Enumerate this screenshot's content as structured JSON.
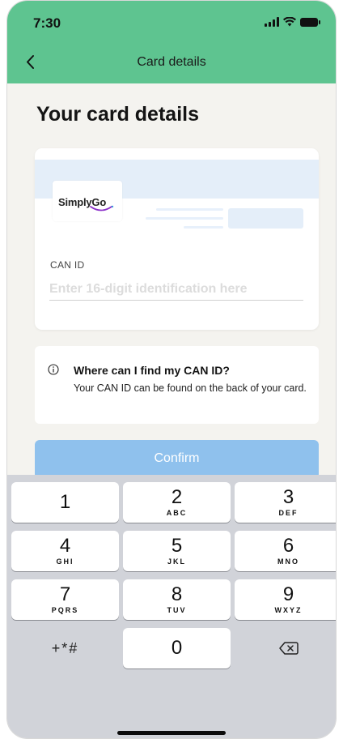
{
  "status_bar": {
    "time": "7:30"
  },
  "nav": {
    "title": "Card details"
  },
  "page": {
    "title": "Your card details"
  },
  "card": {
    "logo_text": "SimplyGo",
    "can_label": "CAN ID",
    "can_placeholder": "Enter 16-digit identification here",
    "can_value": ""
  },
  "info": {
    "title": "Where can I find my CAN ID?",
    "body": "Your CAN ID can be found on the back of your card."
  },
  "confirm_label": "Confirm",
  "keypad": {
    "keys": [
      {
        "num": "1",
        "letters": ""
      },
      {
        "num": "2",
        "letters": "ABC"
      },
      {
        "num": "3",
        "letters": "DEF"
      },
      {
        "num": "4",
        "letters": "GHI"
      },
      {
        "num": "5",
        "letters": "JKL"
      },
      {
        "num": "6",
        "letters": "MNO"
      },
      {
        "num": "7",
        "letters": "PQRS"
      },
      {
        "num": "8",
        "letters": "TUV"
      },
      {
        "num": "9",
        "letters": "WXYZ"
      },
      {
        "num": "0",
        "letters": ""
      }
    ],
    "symbols_label": "+*#",
    "delete_icon": "backspace-icon"
  },
  "colors": {
    "header": "#5ec490",
    "confirm_disabled": "#8fc1ed",
    "keyboard_bg": "#d1d3d9",
    "logo_smile": "#8b2fc9"
  }
}
